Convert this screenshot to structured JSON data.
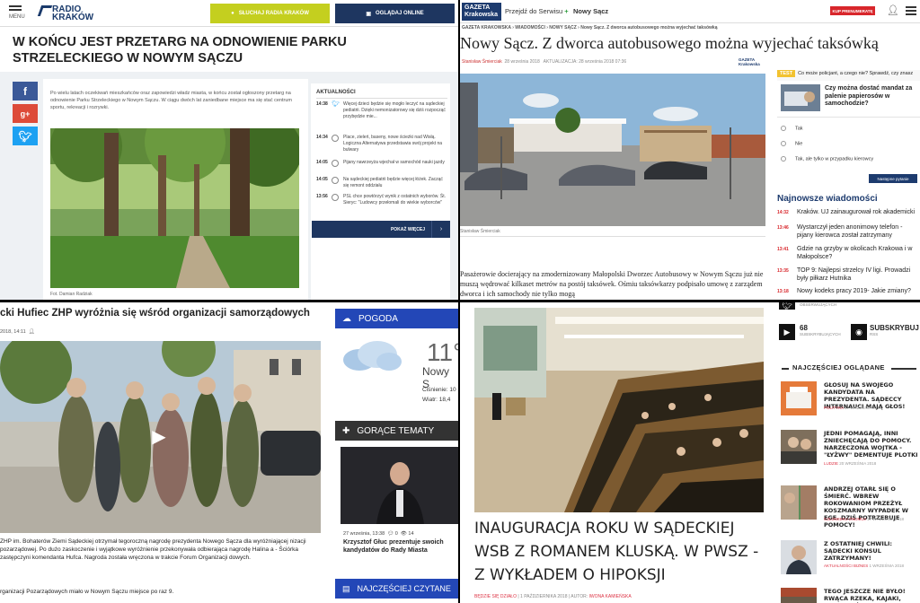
{
  "q1": {
    "menu": "MENU",
    "logo": "RADIO KRAKÓW",
    "listen_button": "SŁUCHAJ RADIA KRAKÓW",
    "watch_button": "OGLĄDAJ ONLINE",
    "title": "W KOŃCU JEST PRZETARG NA ODNOWIENIE PARKU STRZELECKIEGO W NOWYM SĄCZU",
    "lead": "Po wielu latach oczekiwań mieszkańców oraz zapowiedzi władz miasta, w końcu został ogłoszony przetarg na odnowienie Parku Strzeleckiego w Nowym Sączu. W ciągu dwóch lat zaniedbane miejsce ma się stać centrum sportu, rekreacji i rozrywki.",
    "caption": "Fot. Damian Radziak",
    "sidebar_heading": "AKTUALNOŚCI",
    "news": [
      {
        "time": "14:38",
        "text": "Więcej dzieci będzie się mogło leczyć na sądeckiej pediatrii. Dzięki nemonizatorowy się dziś rozpocząć przybędzie mie..."
      },
      {
        "time": "14:34",
        "text": "Place, zieleń, baseny, nowe ścieżki nad Wisłą. Logiczna Alternatywa przedstawia swój projekt na bulwary"
      },
      {
        "time": "14:05",
        "text": "Pijany nawrzeyża wjechał w samochód nauki jazdy"
      },
      {
        "time": "14:05",
        "text": "Na sądeckiej pediatrii będzie więcej łóżek. Zacząć się remont oddziału"
      },
      {
        "time": "13:56",
        "text": "PSL chce powtórzyć wynik z ostatnich wyborów. Śt. Sieryc: \"Ludowcy przełomali do wiekie wyborców\""
      }
    ],
    "more_button": "POKAŻ WIĘCEJ"
  },
  "q2": {
    "logo": "GAZETA Krakowska",
    "nav1": "Przejdź do Serwisu",
    "nav2": "Nowy Sącz",
    "subscribe": "KUP PRENUMERATĘ",
    "breadcrumb": "GAZETA KRAKOWSKA  ›  WIADOMOŚCI  ›  NOWY SĄCZ  ›  Nowy Sącz. Z dworca autobusowego można wyjechać taksówką",
    "title": "Nowy Sącz. Z dworca autobusowego można wyjechać taksówką",
    "author": "Stanisław Śmierciak",
    "published": "28 września 2018",
    "updated": "AKTUALIZACJA: 28 września 2018 07:36",
    "photo_credit": "Stanisław Śmierciak",
    "text": "Pasażerowie docierający na zmodernizowany Małopolski Dworzec Autobusowy w Nowym Sączu już nie muszą wędrować kilkaset metrów na postój taksówek. Ośmiu taksówkarzy podpisało umowę z zarządem dworca i ich samochody nie tylko mogą",
    "quiz_tag": "TEST",
    "quiz_header": "Co może policjant, a czego nie? Sprawdź, czy znasz",
    "quiz_question": "Czy można dostać mandat za palenie papierosów w samochodzie?",
    "options": [
      "Tak",
      "Nie",
      "Tak, ale tylko w przypadku kierowcy"
    ],
    "next_button": "Następne pytanie",
    "latest_heading": "Najnowsze wiadomości",
    "latest": [
      {
        "time": "14:32",
        "text": "Kraków. UJ zainaugurował rok akademicki"
      },
      {
        "time": "13:46",
        "text": "Wystarczył jeden anonimowy telefon - pijany kierowca został zatrzymany"
      },
      {
        "time": "13:41",
        "text": "Gdzie na grzyby w okolicach Krakowa i w Małopolsce?"
      },
      {
        "time": "13:35",
        "text": "TOP 9: Najlepsi strzelcy IV ligi. Prowadzi były piłkarz Hutnika"
      },
      {
        "time": "13:18",
        "text": "Nowy kodeks pracy 2019- Jakie zmiany?"
      }
    ]
  },
  "q3": {
    "title": "cki Hufiec ZHP wyróżnia się wśród organizacji samorządowych",
    "date": "2018, 14:11",
    "text": "ZHP im. Bohaterów Ziemi Sądeckiej otrzymał tegoroczną nagrodę prezydenta Nowego Sącza dla wyróżniającej nizacji pozarządowej. Po dużo zaskoczenie i wyjątkowe wyróżnienie przekonywała odbierająca nagrodę Halina a - Ściórka zastępczyni komendanta Hufca. Nagroda została wręczona w trakcie Forum Organizacji dowych.",
    "text2": "rganizacji Pozarządowych miało w Nowym Sączu miejsce po raz 9.",
    "weather_heading": "POGODA",
    "temperature": "11°",
    "city": "Nowy S",
    "pressure": "Ciśnienie: 10",
    "wind": "Wiatr: 18,4",
    "hot_heading": "GORĄCE TEMATY",
    "hot_date": "27 września, 13:38",
    "hot_count": "0",
    "hot_views": "14",
    "hot_text": "Krzysztof Głuc prezentuje swoich kandydatów do Rady Miasta",
    "top_heading": "NAJCZĘŚCIEJ CZYTANE"
  },
  "q4": {
    "title": "INAUGURACJA ROKU W SĄDECKIEJ WSB Z ROMANEM KLUSKĄ. W PWSZ - Z WYKŁADEM O HIPOKSJI",
    "meta_section": "BĘDZIE SIĘ DZIAŁO",
    "meta_date": "1 PAŹDZIERNIKA 2018",
    "meta_author_label": "AUTOR:",
    "meta_author": "IWONA KAMIEŃSKA",
    "social": [
      {
        "count": "",
        "label": "OBSERWUJĄCYCH"
      },
      {
        "count": "68",
        "label": "SUBSKRYBUJĄCYCH"
      },
      {
        "count": "SUBSKRYBUJ",
        "label": "RSS"
      }
    ],
    "most_heading": "NAJCZĘŚCIEJ OGLĄDANE",
    "items": [
      {
        "text": "GŁOSUJ NA SWOJEGO KANDYDATA NA PREZYDENTA. SĄDECCY INTERNAUCI MAJĄ GŁOS!",
        "section": "POLITYKA",
        "date": "17 WRZEŚNIA 2018"
      },
      {
        "text": "JEDNI POMAGAJĄ, INNI ZNIECHĘCAJĄ DO POMOCY. NARZECZONA WOJTKA - \"ŁYŻWY\" DEMENTUJE PLOTKI",
        "section": "LUDZIE",
        "date": "20 WRZEŚNIA 2018"
      },
      {
        "text": "ANDRZEJ OTARŁ SIĘ O ŚMIERĆ. WBREW ROKOWANIOM PRZEŻYŁ KOSZMARNY WYPADEK W EGE. DZIŚ POTRZEBUJE POMOCY!",
        "section": "CZŁOWIEKU ZNIJMUJ",
        "date": "17 WRZEŚNIA 2018"
      },
      {
        "text": "Z OSTATNIEJ CHWILI: SĄDECKI KONSUL ZATRZYMANY!",
        "section": "AKTUALNOŚCI BIZNES",
        "date": "1 WRZEŚNIA 2018"
      },
      {
        "text": "TEGO JESZCZE NIE BYŁO! RWĄCA RZEKA, KAJAKI, NOWY POŻAR",
        "section": "",
        "date": ""
      }
    ]
  }
}
